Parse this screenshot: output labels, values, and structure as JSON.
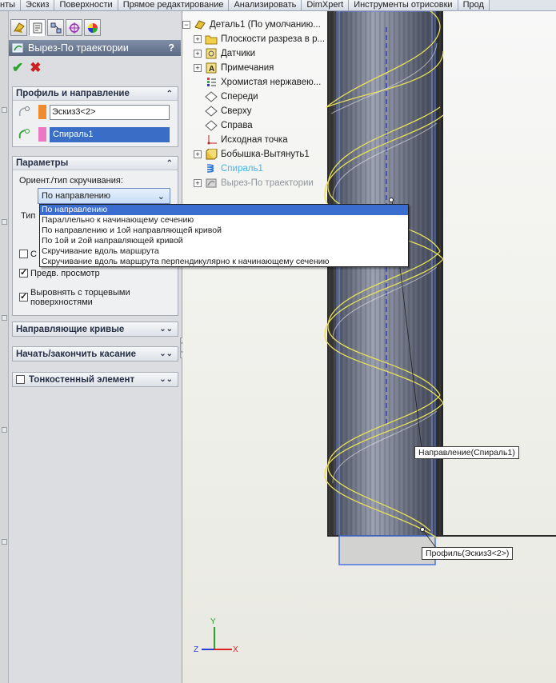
{
  "tabs": [
    "нты",
    "Эскиз",
    "Поверхности",
    "Прямое редактирование",
    "Анализировать",
    "DimXpert",
    "Инструменты отрисовки",
    "Прод"
  ],
  "pm": {
    "title": "Вырез-По траектории",
    "help": "?",
    "profile_group": {
      "title": "Профиль и направление",
      "profile_value": "Эскиз3<2>",
      "path_value": "Спираль1",
      "profile_color": "#ef8a2f",
      "path_color": "#e879c2"
    },
    "params_group": {
      "title": "Параметры",
      "orient_label": "Ориент./тип скручивания:",
      "orient_selected": "По направлению",
      "tangency_label_fragment": "Тип",
      "options": [
        "По направлению",
        "Параллельно к начинающему сечению",
        "По направлению и 1ой  направляющей кривой",
        "По  1ой  и 2ой направляющей кривой",
        "Скручивание вдоль маршрута",
        "Скручивание вдоль маршрута перпендикулярно к начинающему сечению"
      ],
      "hidden_check_fragment": "С",
      "preview_label": "Предв. просмотр",
      "preview_checked": true,
      "align_label_1": "Выровнять с торцевыми",
      "align_label_2": "поверхностями",
      "align_checked": true
    },
    "guide_group": "Направляющие кривые",
    "tangency_group": "Начать/закончить касание",
    "thin_group": "Тонкостенный элемент",
    "thin_checked": false
  },
  "tree": [
    {
      "label": "Деталь1  (По умолчанию...",
      "expander": "−",
      "icon": "part-icon",
      "style": "normal"
    },
    {
      "label": "Плоскости разреза в р...",
      "expander": "+",
      "icon": "folder-icon",
      "style": "normal"
    },
    {
      "label": "Датчики",
      "expander": "+",
      "icon": "sensor-icon",
      "style": "normal"
    },
    {
      "label": "Примечания",
      "expander": "+",
      "icon": "annotation-icon",
      "style": "normal"
    },
    {
      "label": "Хромистая нержавею...",
      "expander": "",
      "icon": "material-icon",
      "style": "normal"
    },
    {
      "label": "Спереди",
      "expander": "",
      "icon": "plane-icon",
      "style": "normal"
    },
    {
      "label": "Сверху",
      "expander": "",
      "icon": "plane-icon",
      "style": "normal"
    },
    {
      "label": "Справа",
      "expander": "",
      "icon": "plane-icon",
      "style": "normal"
    },
    {
      "label": "Исходная точка",
      "expander": "",
      "icon": "origin-icon",
      "style": "normal"
    },
    {
      "label": "Бобышка-Вытянуть1",
      "expander": "+",
      "icon": "extrude-icon",
      "style": "normal"
    },
    {
      "label": "Спираль1",
      "expander": "",
      "icon": "helix-icon",
      "style": "blue"
    },
    {
      "label": "Вырез-По траектории",
      "expander": "+",
      "icon": "sweep-cut-icon",
      "style": "gray"
    }
  ],
  "viewport": {
    "path_callout": "Направление(Спираль1)",
    "profile_callout": "Профиль(Эскиз3<2>)",
    "axis_x": "X",
    "axis_y": "Y",
    "axis_z": "Z"
  }
}
